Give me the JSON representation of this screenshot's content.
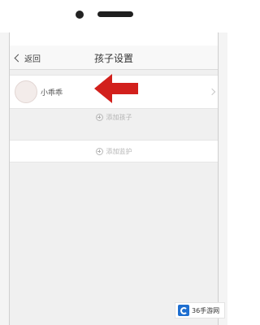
{
  "navbar": {
    "back_label": "返回",
    "title": "孩子设置"
  },
  "child": {
    "name": "小乖乖"
  },
  "actions": {
    "add_child_label": "添加孩子",
    "add_guardian_label": "添加监护"
  },
  "watermark": {
    "text": "36手游网"
  },
  "colors": {
    "annotation_arrow": "#d2201c",
    "background": "#f0f0f0"
  },
  "icons": [
    "chevron-left-icon",
    "avatar",
    "chevron-right-icon",
    "plus-circle-icon",
    "red-arrow-annotation"
  ]
}
